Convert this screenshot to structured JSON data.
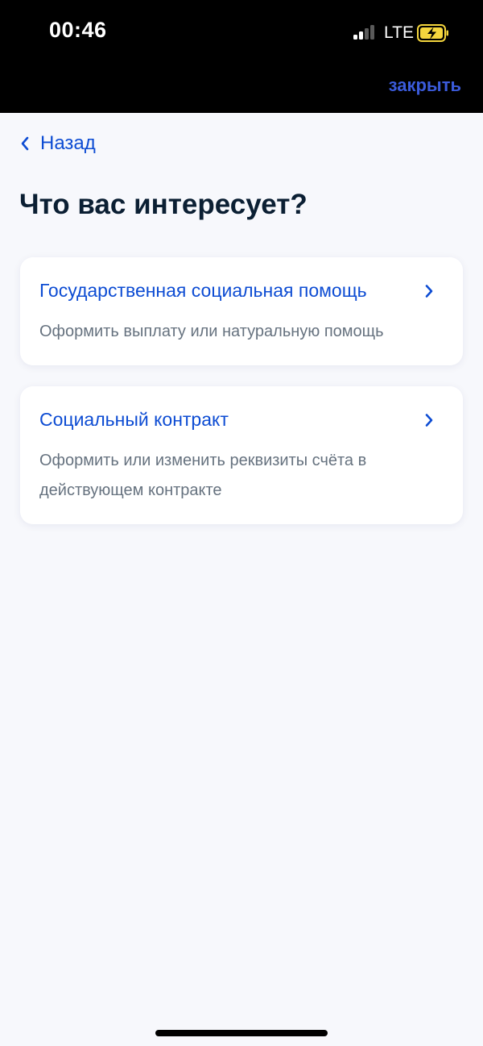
{
  "status_bar": {
    "time": "00:46",
    "network": "LTE"
  },
  "header": {
    "close_label": "закрыть"
  },
  "nav": {
    "back_label": "Назад"
  },
  "page": {
    "title": "Что вас интересует?"
  },
  "options": [
    {
      "title": "Государственная социальная помощь",
      "description": "Оформить выплату или натуральную помощь"
    },
    {
      "title": "Социальный контракт",
      "description": "Оформить или изменить реквизиты счёта в действующем контракте"
    }
  ],
  "icons": {
    "back": "chevron-left-icon",
    "option": "chevron-right-icon",
    "signal": "signal-icon",
    "battery": "battery-charging-icon"
  },
  "colors": {
    "accent": "#0d4cd3",
    "close_link": "#3b5bdb",
    "title": "#0b1f33",
    "secondary_text": "#66727f",
    "background": "#f7f8fc",
    "battery_charge": "#f5d63d"
  }
}
